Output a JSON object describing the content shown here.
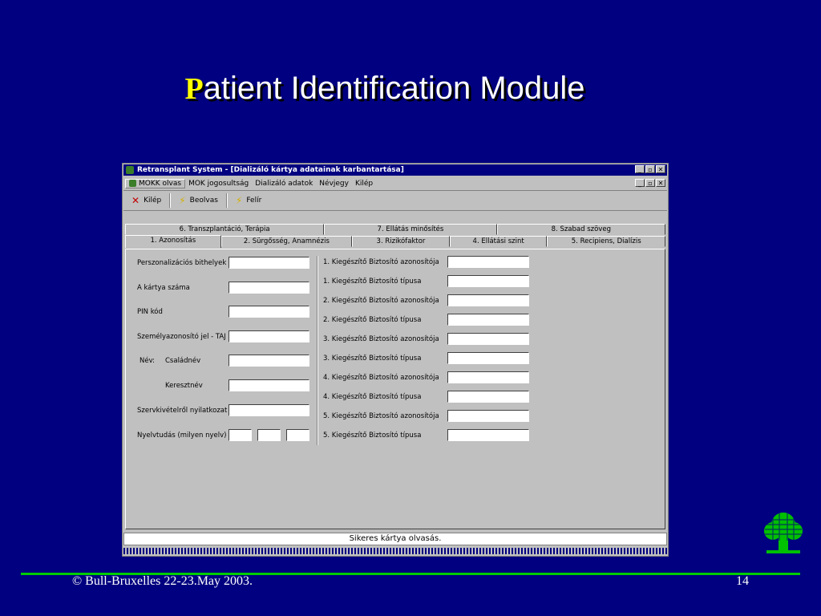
{
  "slide": {
    "title_first": "P",
    "title_rest": "atient Identification Module",
    "footer_left": "© Bull-Bruxelles 22-23.May 2003.",
    "footer_right": "14"
  },
  "window": {
    "title": "Retransplant System - [Dializáló kártya adatainak karbantartása]",
    "menu": [
      "MOKK olvas",
      "MOK jogosultság",
      "Dializáló adatok",
      "Névjegy",
      "Kilép"
    ],
    "toolbar": {
      "exit": "Kilép",
      "read": "Beolvas",
      "write": "Felír"
    },
    "tabs_back": [
      "6. Transzplantáció, Terápia",
      "7. Ellátás minősítés",
      "8. Szabad szöveg"
    ],
    "tabs_front": [
      "1. Azonosítás",
      "2. Sürgősség, Anamnézis",
      "3. Rizikófaktor",
      "4. Ellátási szint",
      "5. Recipiens, Dialízis"
    ],
    "left_fields": {
      "pers": "Perszonalizációs bithelyek",
      "card_no": "A kártya száma",
      "pin": "PIN kód",
      "taj": "Személyazonosító jel - TAJ",
      "name": "Név:",
      "family": "Családnév",
      "given": "Keresztnév",
      "organ": "Szervkivételről nyilatkozat",
      "lang": "Nyelvtudás (milyen nyelv)"
    },
    "right_fields": [
      "1. Kiegészítő Biztosító azonosítója",
      "1. Kiegészítő Biztosító típusa",
      "2. Kiegészítő Biztosító azonosítója",
      "2. Kiegészítő Biztosító típusa",
      "3. Kiegészítő Biztosító azonosítója",
      "3. Kiegészítő Biztosító típusa",
      "4. Kiegészítő Biztosító azonosítója",
      "4. Kiegészítő Biztosító típusa",
      "5. Kiegészítő Biztosító azonosítója",
      "5. Kiegészítő Biztosító típusa"
    ],
    "status": "Sikeres kártya olvasás.",
    "win_buttons": [
      "_",
      "▫",
      "✕"
    ]
  }
}
